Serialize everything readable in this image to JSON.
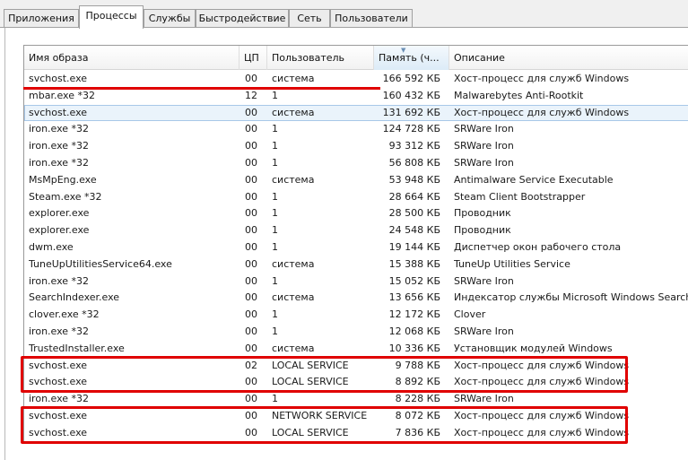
{
  "tabs": [
    {
      "label": "Приложения",
      "active": false
    },
    {
      "label": "Процессы",
      "active": true
    },
    {
      "label": "Службы",
      "active": false
    },
    {
      "label": "Быстродействие",
      "active": false
    },
    {
      "label": "Сеть",
      "active": false
    },
    {
      "label": "Пользователи",
      "active": false
    }
  ],
  "columns": {
    "name": "Имя образа",
    "cpu": "ЦП",
    "user": "Пользователь",
    "memory": "Память (ч...",
    "description": "Описание"
  },
  "sort": {
    "column": "memory",
    "direction": "descending"
  },
  "processes": [
    {
      "name": "svchost.exe",
      "cpu": "00",
      "user": "система",
      "memory": "166 592 КБ",
      "description": "Хост-процесс для служб Windows"
    },
    {
      "name": "mbar.exe *32",
      "cpu": "12",
      "user": "1",
      "memory": "160 432 КБ",
      "description": "Malwarebytes Anti-Rootkit"
    },
    {
      "name": "svchost.exe",
      "cpu": "00",
      "user": "система",
      "memory": "131 692 КБ",
      "description": "Хост-процесс для служб Windows"
    },
    {
      "name": "iron.exe *32",
      "cpu": "00",
      "user": "1",
      "memory": "124 728 КБ",
      "description": "SRWare Iron"
    },
    {
      "name": "iron.exe *32",
      "cpu": "00",
      "user": "1",
      "memory": "93 312 КБ",
      "description": "SRWare Iron"
    },
    {
      "name": "iron.exe *32",
      "cpu": "00",
      "user": "1",
      "memory": "56 808 КБ",
      "description": "SRWare Iron"
    },
    {
      "name": "MsMpEng.exe",
      "cpu": "00",
      "user": "система",
      "memory": "53 948 КБ",
      "description": "Antimalware Service Executable"
    },
    {
      "name": "Steam.exe *32",
      "cpu": "00",
      "user": "1",
      "memory": "28 664 КБ",
      "description": "Steam Client Bootstrapper"
    },
    {
      "name": "explorer.exe",
      "cpu": "00",
      "user": "1",
      "memory": "28 500 КБ",
      "description": "Проводник"
    },
    {
      "name": "explorer.exe",
      "cpu": "00",
      "user": "1",
      "memory": "24 548 КБ",
      "description": "Проводник"
    },
    {
      "name": "dwm.exe",
      "cpu": "00",
      "user": "1",
      "memory": "19 144 КБ",
      "description": "Диспетчер окон рабочего стола"
    },
    {
      "name": "TuneUpUtilitiesService64.exe",
      "cpu": "00",
      "user": "система",
      "memory": "15 388 КБ",
      "description": "TuneUp Utilities Service"
    },
    {
      "name": "iron.exe *32",
      "cpu": "00",
      "user": "1",
      "memory": "15 052 КБ",
      "description": "SRWare Iron"
    },
    {
      "name": "SearchIndexer.exe",
      "cpu": "00",
      "user": "система",
      "memory": "13 656 КБ",
      "description": "Индексатор службы Microsoft Windows Search"
    },
    {
      "name": "clover.exe *32",
      "cpu": "00",
      "user": "1",
      "memory": "12 172 КБ",
      "description": "Clover"
    },
    {
      "name": "iron.exe *32",
      "cpu": "00",
      "user": "1",
      "memory": "12 068 КБ",
      "description": "SRWare Iron"
    },
    {
      "name": "TrustedInstaller.exe",
      "cpu": "00",
      "user": "система",
      "memory": "10 336 КБ",
      "description": "Установщик модулей Windows"
    },
    {
      "name": "svchost.exe",
      "cpu": "02",
      "user": "LOCAL SERVICE",
      "memory": "9 788 КБ",
      "description": "Хост-процесс для служб Windows"
    },
    {
      "name": "svchost.exe",
      "cpu": "00",
      "user": "LOCAL SERVICE",
      "memory": "8 892 КБ",
      "description": "Хост-процесс для служб Windows"
    },
    {
      "name": "iron.exe *32",
      "cpu": "00",
      "user": "1",
      "memory": "8 228 КБ",
      "description": "SRWare Iron"
    },
    {
      "name": "svchost.exe",
      "cpu": "00",
      "user": "NETWORK SERVICE",
      "memory": "8 072 КБ",
      "description": "Хост-процесс для служб Windows"
    },
    {
      "name": "svchost.exe",
      "cpu": "00",
      "user": "LOCAL SERVICE",
      "memory": "7 836 КБ",
      "description": "Хост-процесс для служб Windows"
    }
  ],
  "selected_row": 2,
  "highlight_color": "#e00000",
  "highlights": {
    "underlined_rows": [
      0
    ],
    "boxed_groups": [
      [
        17,
        18
      ],
      [
        20,
        21
      ]
    ]
  }
}
